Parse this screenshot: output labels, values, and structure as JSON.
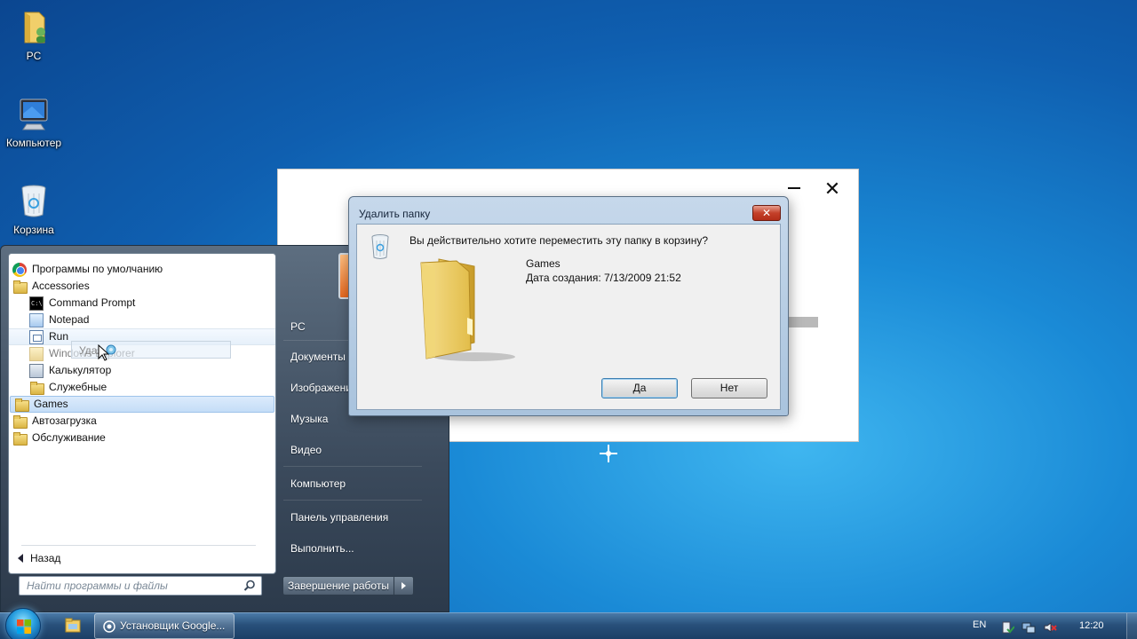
{
  "desktop": {
    "icons": [
      {
        "label": "PC",
        "icon": "user-folder-icon"
      },
      {
        "label": "Компьютер",
        "icon": "computer-icon"
      },
      {
        "label": "Корзина",
        "icon": "recycle-bin-icon"
      }
    ]
  },
  "start_menu": {
    "programs": [
      {
        "label": "Программы по умолчанию",
        "icon": "chrome-icon"
      },
      {
        "label": "Accessories",
        "icon": "folder-icon"
      },
      {
        "label": "Command Prompt",
        "icon": "cmd-icon"
      },
      {
        "label": "Notepad",
        "icon": "notepad-icon"
      },
      {
        "label": "Run",
        "icon": "run-icon"
      },
      {
        "label": "Windows Explorer",
        "icon": "explorer-icon"
      },
      {
        "label": "Калькулятор",
        "icon": "calculator-icon"
      },
      {
        "label": "Служебные",
        "icon": "folder-icon"
      },
      {
        "label": "Games",
        "icon": "folder-icon"
      },
      {
        "label": "Автозагрузка",
        "icon": "folder-icon"
      },
      {
        "label": "Обслуживание",
        "icon": "folder-icon"
      }
    ],
    "drag_ghost_label": "Удал",
    "back_label": "Назад",
    "search_placeholder": "Найти программы и файлы",
    "right_items": [
      "PC",
      "Документы",
      "Изображения",
      "Музыка",
      "Видео",
      "Компьютер",
      "Панель управления",
      "Выполнить..."
    ],
    "shutdown_label": "Завершение работы"
  },
  "dialog": {
    "title": "Удалить папку",
    "close_label": "✕",
    "question": "Вы действительно хотите переместить эту папку в корзину?",
    "item_name": "Games",
    "item_date": "Дата создания: 7/13/2009 21:52",
    "yes_label": "Да",
    "no_label": "Нет"
  },
  "background_window": {
    "close_label": "✕"
  },
  "taskbar": {
    "task_label": "Установщик Google...",
    "language": "EN",
    "clock": "12:20"
  },
  "colors": {
    "desktop": "#1a8ad6",
    "start_menu": "#3b4a5c",
    "dialog_frame": "#a9c3dd",
    "dialog_close": "#c4402a",
    "taskbar": "#28507a"
  }
}
